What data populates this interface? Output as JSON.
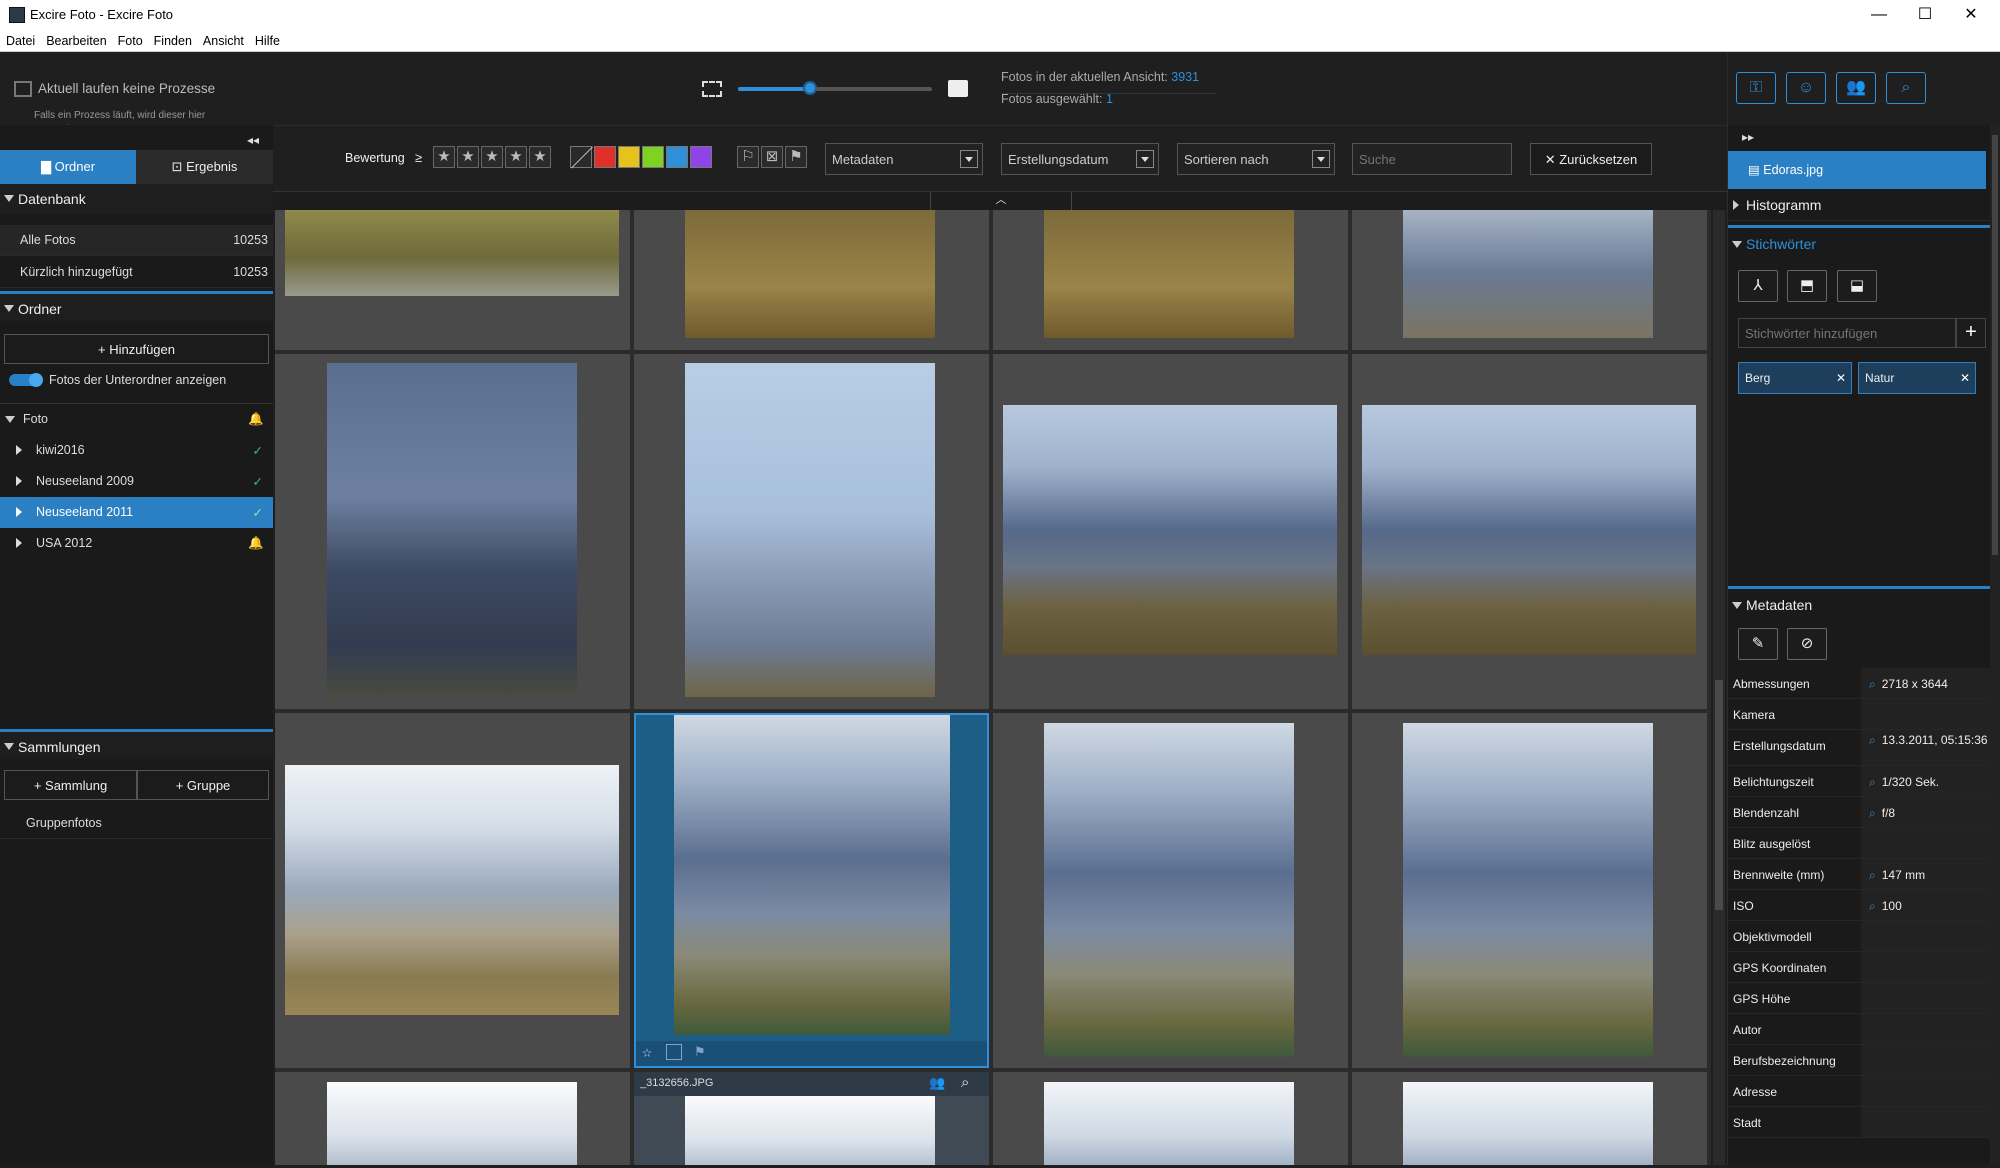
{
  "window": {
    "app_title": "Excire Foto - Excire Foto",
    "minimize": "—",
    "maximize": "☐",
    "close": "✕"
  },
  "menu": [
    "Datei",
    "Bearbeiten",
    "Foto",
    "Finden",
    "Ansicht",
    "Hilfe"
  ],
  "header": {
    "process_status": "Aktuell laufen keine Prozesse",
    "process_hint": "Falls ein Prozess läuft, wird dieser hier angezeigt.",
    "photos_in_view_label": "Fotos in der aktuellen Ansicht:",
    "photos_in_view_value": "3931",
    "photos_selected_label": "Fotos ausgewählt:",
    "photos_selected_value": "1",
    "zoom_slider_level": 0.37
  },
  "left": {
    "tabs": {
      "folder": "Ordner",
      "result": "Ergebnis"
    },
    "database": {
      "title": "Datenbank",
      "items": [
        {
          "label": "Alle Fotos",
          "count": "10253"
        },
        {
          "label": "Kürzlich hinzugefügt",
          "count": "10253"
        }
      ]
    },
    "folders": {
      "title": "Ordner",
      "add": "Hinzufügen",
      "toggle_label": "Fotos der Unterordner anzeigen",
      "root": "Foto",
      "items": [
        {
          "label": "kiwi2016",
          "status": "✓"
        },
        {
          "label": "Neuseeland 2009",
          "status": "✓"
        },
        {
          "label": "Neuseeland 2011",
          "status": "✓"
        },
        {
          "label": "USA 2012",
          "status": "🔔"
        }
      ]
    },
    "collections": {
      "title": "Sammlungen",
      "add_collection": "Sammlung",
      "add_group": "Gruppe",
      "item": "Gruppenfotos"
    }
  },
  "toolbar": {
    "rating_label": "Bewertung",
    "rating_op": "≥",
    "color_labels": [
      "#e0302a",
      "#e8c21c",
      "#7ed321",
      "#2f8fd8",
      "#8e44e8"
    ],
    "metadata": "Metadaten",
    "date": "Erstellungsdatum",
    "sort": "Sortieren nach",
    "search_placeholder": "Suche",
    "reset": "Zurücksetzen"
  },
  "grid": {
    "hover_filename": "_3132656.JPG"
  },
  "right": {
    "file": "Edoras.jpg",
    "histogram": "Histogramm",
    "keywords": {
      "title": "Stichwörter",
      "add_placeholder": "Stichwörter hinzufügen",
      "tags": [
        "Berg",
        "Natur"
      ]
    },
    "metadata": {
      "title": "Metadaten",
      "rows": [
        {
          "k": "Abmessungen",
          "v": "2718 x 3644"
        },
        {
          "k": "Kamera",
          "v": ""
        },
        {
          "k": "Erstellungsdatum",
          "v": "13.3.2011, 05:15:36"
        },
        {
          "k": "Belichtungszeit",
          "v": "1/320 Sek."
        },
        {
          "k": "Blendenzahl",
          "v": "f/8"
        },
        {
          "k": "Blitz ausgelöst",
          "v": ""
        },
        {
          "k": "Brennweite (mm)",
          "v": "147 mm"
        },
        {
          "k": "ISO",
          "v": "100"
        },
        {
          "k": "Objektivmodell",
          "v": ""
        },
        {
          "k": "GPS Koordinaten",
          "v": ""
        },
        {
          "k": "GPS Höhe",
          "v": ""
        },
        {
          "k": "Autor",
          "v": ""
        },
        {
          "k": "Berufsbezeichnung",
          "v": ""
        },
        {
          "k": "Adresse",
          "v": ""
        },
        {
          "k": "Stadt",
          "v": ""
        }
      ]
    }
  }
}
